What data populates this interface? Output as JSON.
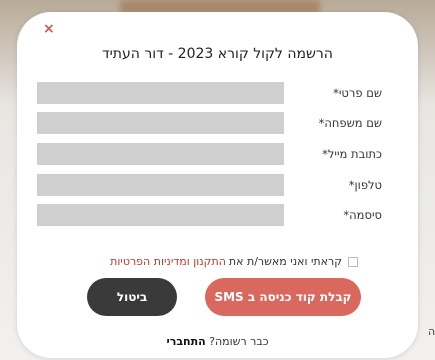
{
  "modal": {
    "close_symbol": "×",
    "title": "הרשמה לקול קורא 2023 - דור העתיד"
  },
  "form": {
    "fields": [
      {
        "label": "שם פרטי*",
        "value": ""
      },
      {
        "label": "שם משפחה*",
        "value": ""
      },
      {
        "label": "כתובת מייל*",
        "value": ""
      },
      {
        "label": "טלפון*",
        "value": ""
      },
      {
        "label": "סיסמה*",
        "value": ""
      }
    ],
    "terms_text": "קראתי ואני מאשר/ת את",
    "terms_link": "התקנון ומדיניות הפרטיות"
  },
  "buttons": {
    "sms": "קבלת קוד כניסה ב SMS",
    "cancel": "ביטול"
  },
  "footer": {
    "question": "כבר רשומה?",
    "login": "התחברי"
  },
  "background": {
    "edge_char": "ה"
  },
  "colors": {
    "accent": "#d9695f",
    "close": "#d9534f",
    "dark_button": "#3a3a3a",
    "input_bg": "#cfcfcf",
    "link": "#c0392b"
  }
}
